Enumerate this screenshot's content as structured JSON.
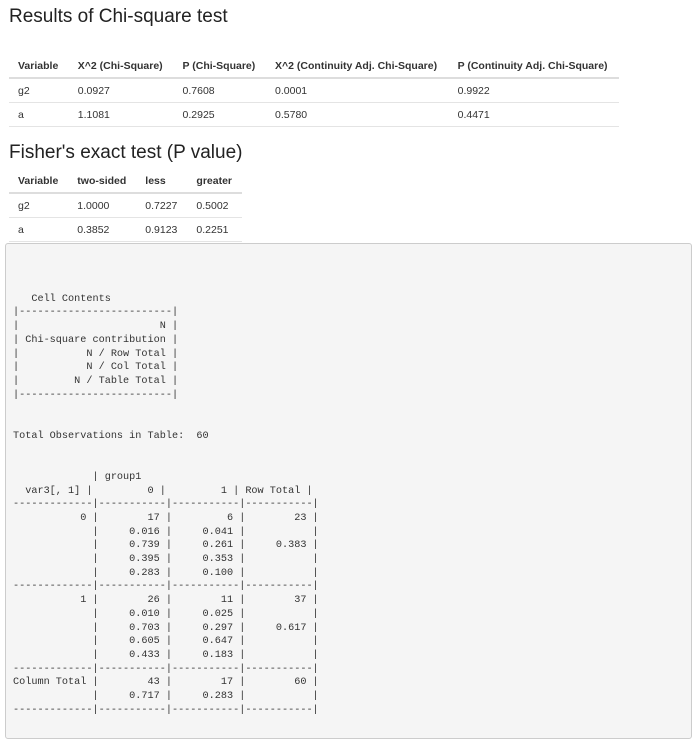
{
  "chi_square": {
    "title": "Results of Chi-square test",
    "headers": [
      "Variable",
      "X^2 (Chi-Square)",
      "P (Chi-Square)",
      "X^2 (Continuity Adj. Chi-Square)",
      "P (Continuity Adj. Chi-Square)"
    ],
    "rows": [
      [
        "g2",
        "0.0927",
        "0.7608",
        "0.0001",
        "0.9922"
      ],
      [
        "a",
        "1.1081",
        "0.2925",
        "0.5780",
        "0.4471"
      ]
    ]
  },
  "fisher": {
    "title": "Fisher's exact test (P value)",
    "headers": [
      "Variable",
      "two-sided",
      "less",
      "greater"
    ],
    "rows": [
      [
        "g2",
        "1.0000",
        "0.7227",
        "0.5002"
      ],
      [
        "a",
        "0.3852",
        "0.9123",
        "0.2251"
      ]
    ]
  },
  "console_output": "\n   Cell Contents\n|-------------------------|\n|                       N |\n| Chi-square contribution |\n|           N / Row Total |\n|           N / Col Total |\n|         N / Table Total |\n|-------------------------|\n\n\nTotal Observations in Table:  60\n\n\n             | group1\n  var3[, 1] |         0 |         1 | Row Total |\n-------------|-----------|-----------|-----------|\n           0 |        17 |         6 |        23 |\n             |     0.016 |     0.041 |           |\n             |     0.739 |     0.261 |     0.383 |\n             |     0.395 |     0.353 |           |\n             |     0.283 |     0.100 |           |\n-------------|-----------|-----------|-----------|\n           1 |        26 |        11 |        37 |\n             |     0.010 |     0.025 |           |\n             |     0.703 |     0.297 |     0.617 |\n             |     0.605 |     0.647 |           |\n             |     0.433 |     0.183 |           |\n-------------|-----------|-----------|-----------|\nColumn Total |        43 |        17 |        60 |\n             |     0.717 |     0.283 |           |\n-------------|-----------|-----------|-----------|\n"
}
